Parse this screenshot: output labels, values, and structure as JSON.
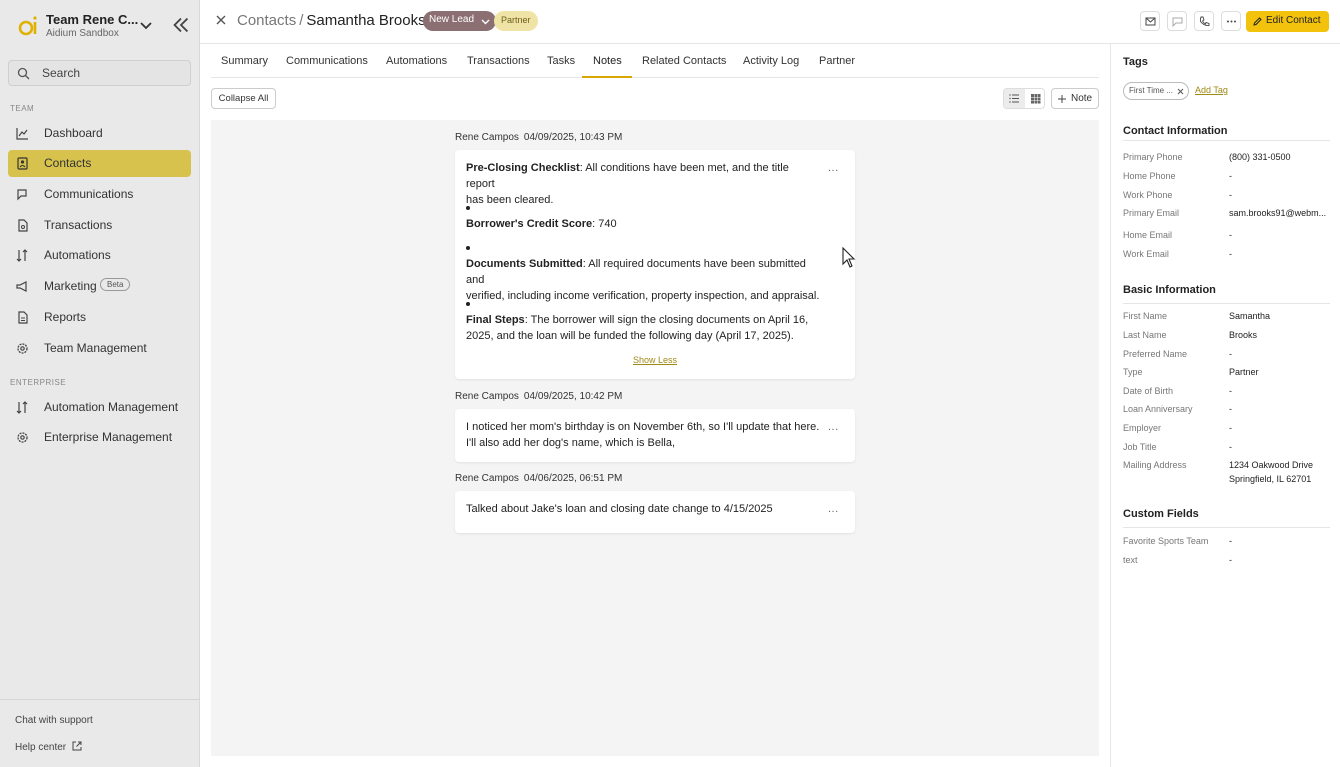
{
  "colors": {
    "accent": "#f2c20c",
    "active_nav": "#d6c24d",
    "lead_badge": "#8b6f72",
    "partner_badge": "#f0e3a6"
  },
  "sidebar": {
    "team_name": "Team Rene C...",
    "team_sub": "Aidium Sandbox",
    "search_placeholder": "Search",
    "section_team": "TEAM",
    "section_enterprise": "ENTERPRISE",
    "items": [
      {
        "label": "Dashboard",
        "icon": "chart-line-icon"
      },
      {
        "label": "Contacts",
        "icon": "contacts-icon",
        "active": true
      },
      {
        "label": "Communications",
        "icon": "chat-icon"
      },
      {
        "label": "Transactions",
        "icon": "document-icon"
      },
      {
        "label": "Automations",
        "icon": "sort-icon"
      },
      {
        "label": "Marketing",
        "icon": "megaphone-icon",
        "badge": "Beta"
      },
      {
        "label": "Reports",
        "icon": "report-icon"
      },
      {
        "label": "Team Management",
        "icon": "gear-icon"
      }
    ],
    "enterprise_items": [
      {
        "label": "Automation Management",
        "icon": "sort-icon"
      },
      {
        "label": "Enterprise Management",
        "icon": "gear-icon"
      }
    ],
    "chat_support": "Chat with support",
    "help_center": "Help center"
  },
  "header": {
    "breadcrumb_root": "Contacts",
    "breadcrumb_sep": "/",
    "contact_name": "Samantha Brooks",
    "status_badge": "New Lead",
    "type_badge": "Partner",
    "edit_label": "Edit Contact"
  },
  "tabs": [
    "Summary",
    "Communications",
    "Automations",
    "Transactions",
    "Tasks",
    "Notes",
    "Related Contacts",
    "Activity Log",
    "Partner"
  ],
  "active_tab": "Notes",
  "toolbar": {
    "collapse_all": "Collapse All",
    "add_note": "Note"
  },
  "notes": [
    {
      "author": "Rene Campos",
      "date": "04/09/2025, 10:43 PM",
      "p1_bold": "Pre-Closing Checklist",
      "p1_line1": ": All conditions have been met, and the title report",
      "p1_line2": "has been cleared.",
      "p2_bold": "Borrower's Credit Score",
      "p2_text": ": 740",
      "p3_bold": "Documents Submitted",
      "p3_line1": ": All required documents have been submitted and",
      "p3_line2": "verified, including income verification, property inspection, and appraisal.",
      "p4_bold": "Final Steps",
      "p4_line1": ": The borrower will sign the closing documents on April 16,",
      "p4_line2": "2025, and the loan will be funded the following day (April 17, 2025).",
      "show_less": "Show Less",
      "menu": "..."
    },
    {
      "author": "Rene Campos",
      "date": "04/09/2025, 10:42 PM",
      "line1": "I noticed her mom's birthday is on November 6th, so I'll update that here.",
      "line2": "I'll also add her dog's name, which is Bella,",
      "menu": "..."
    },
    {
      "author": "Rene Campos",
      "date": "04/06/2025, 06:51 PM",
      "line1": "Talked about Jake's loan and closing date change to 4/15/2025",
      "menu": "..."
    }
  ],
  "right_panel": {
    "tags_title": "Tags",
    "tag": "First Time ...",
    "add_tag": "Add Tag",
    "contact_info_title": "Contact Information",
    "contact_info": [
      {
        "label": "Primary Phone",
        "value": "(800) 331-0500"
      },
      {
        "label": "Home Phone",
        "value": "-"
      },
      {
        "label": "Work Phone",
        "value": "-"
      },
      {
        "label": "Primary Email",
        "value": "sam.brooks91@webm..."
      },
      {
        "label": "Home Email",
        "value": "-"
      },
      {
        "label": "Work Email",
        "value": "-"
      }
    ],
    "basic_info_title": "Basic Information",
    "basic_info": [
      {
        "label": "First Name",
        "value": "Samantha"
      },
      {
        "label": "Last Name",
        "value": "Brooks"
      },
      {
        "label": "Preferred Name",
        "value": "-"
      },
      {
        "label": "Type",
        "value": "Partner"
      },
      {
        "label": "Date of Birth",
        "value": "-"
      },
      {
        "label": "Loan Anniversary",
        "value": "-"
      },
      {
        "label": "Employer",
        "value": "-"
      },
      {
        "label": "Job Title",
        "value": "-"
      },
      {
        "label": "Mailing Address",
        "value": "1234 Oakwood Drive",
        "value2": "Springfield, IL 62701"
      }
    ],
    "custom_fields_title": "Custom Fields",
    "custom_fields": [
      {
        "label": "Favorite Sports Team",
        "value": "-"
      },
      {
        "label": "text",
        "value": "-"
      }
    ]
  }
}
